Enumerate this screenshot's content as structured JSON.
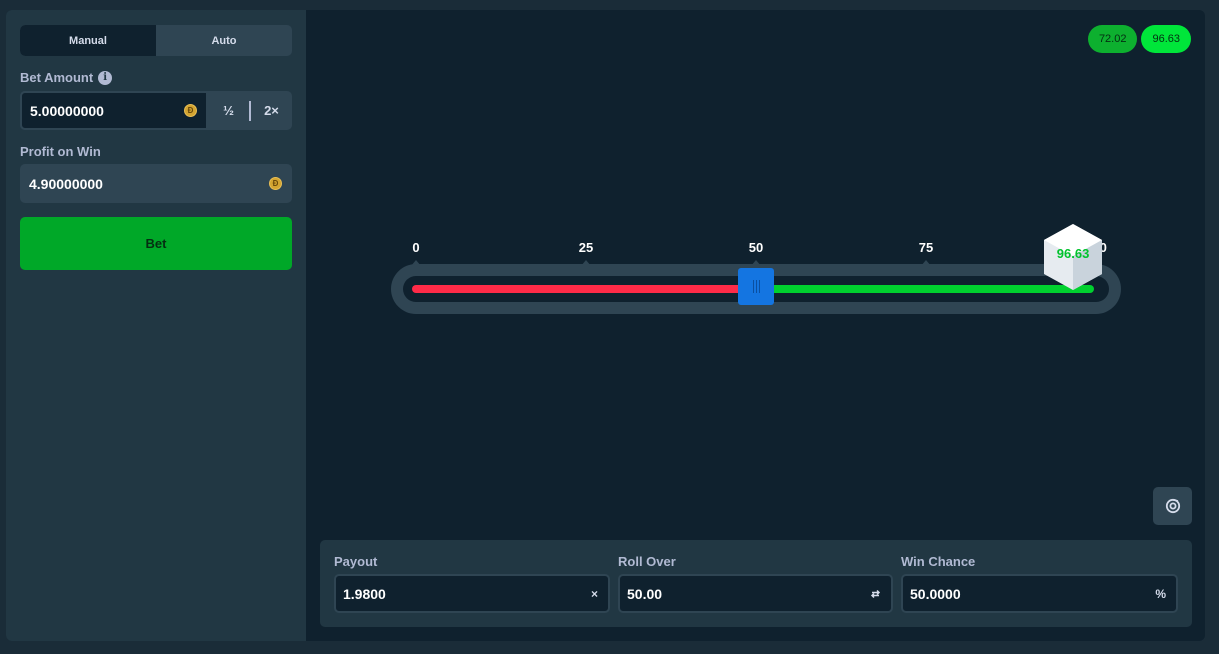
{
  "tabs": [
    {
      "label": "Manual",
      "active": true
    },
    {
      "label": "Auto",
      "active": false
    }
  ],
  "bet_amount": {
    "label": "Bet Amount",
    "info_icon": "info-icon",
    "value": "5.00000000",
    "currency_icon": "coin-icon",
    "half_label": "½",
    "double_label": "2×"
  },
  "profit": {
    "label": "Profit on Win",
    "value": "4.90000000",
    "currency_icon": "coin-icon"
  },
  "bet_button": {
    "label": "Bet"
  },
  "history": [
    "72.02",
    "96.63"
  ],
  "slider": {
    "ticks": [
      "0",
      "25",
      "50",
      "75",
      "100"
    ],
    "roll_over": 50,
    "result": "96.63",
    "result_value": 96.63,
    "colors": {
      "lose": "#ff2b48",
      "win": "#00d12f",
      "handle": "#1475e1"
    }
  },
  "camera_icon": "camera-lens-icon",
  "stats": {
    "payout": {
      "label": "Payout",
      "value": "1.9800",
      "suffix": "×"
    },
    "roll_over": {
      "label": "Roll Over",
      "value": "50.00",
      "suffix_icon": "swap-icon"
    },
    "win_chance": {
      "label": "Win Chance",
      "value": "50.0000",
      "suffix": "%"
    }
  },
  "colors": {
    "background": "#0f212e",
    "panel": "#213743",
    "accent_green": "#00a828"
  }
}
